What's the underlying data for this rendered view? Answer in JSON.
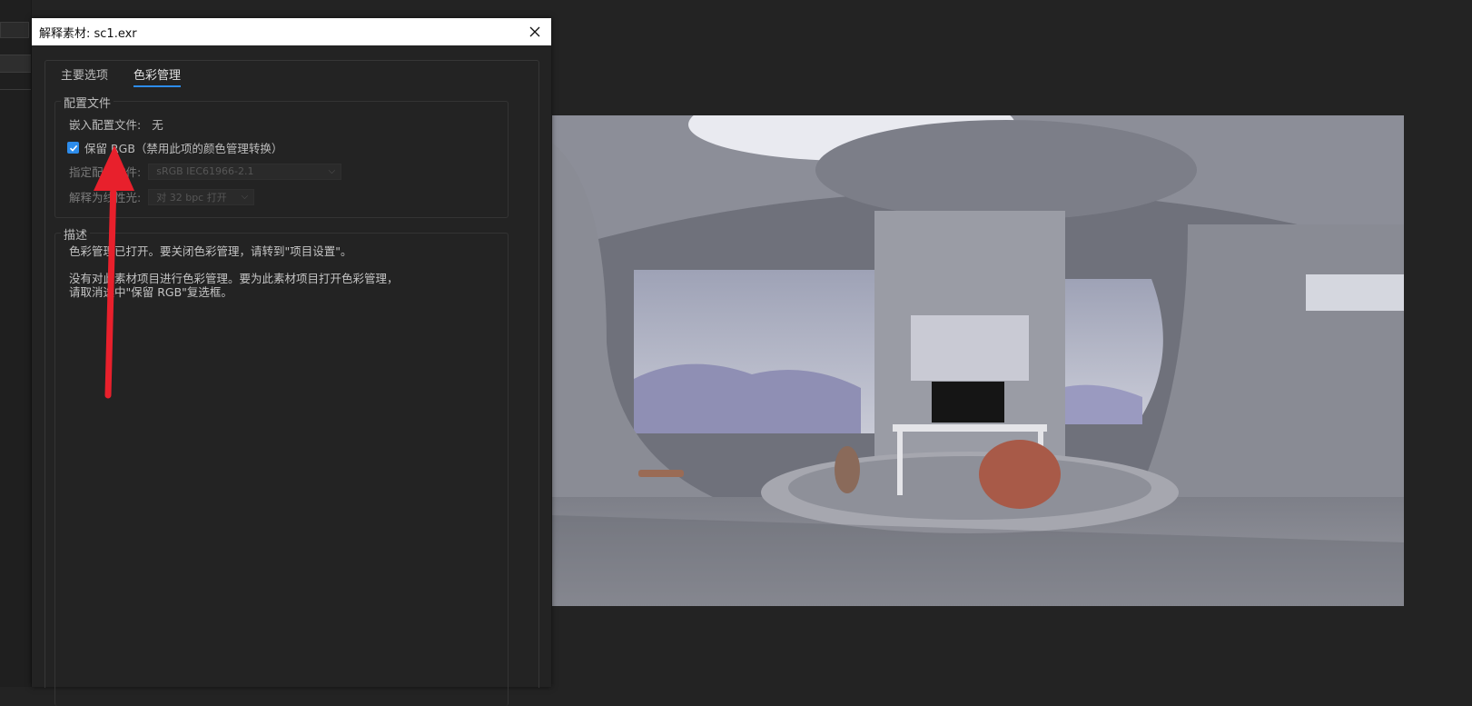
{
  "dialog": {
    "title": "解释素材: sc1.exr",
    "tabs": [
      {
        "label": "主要选项",
        "active": false
      },
      {
        "label": "色彩管理",
        "active": true
      }
    ],
    "profile_group": {
      "title": "配置文件",
      "embedded_label": "嵌入配置文件:",
      "embedded_value": "无",
      "preserve_rgb_label": "保留 RGB（禁用此项的颜色管理转换）",
      "preserve_rgb_checked": true,
      "assign_profile_label": "指定配置文件:",
      "assign_profile_value": "sRGB IEC61966-2.1",
      "interpret_linear_label": "解释为线性光:",
      "interpret_linear_value": "对 32 bpc 打开"
    },
    "description_group": {
      "title": "描述",
      "line1": "色彩管理已打开。要关闭色彩管理，请转到\"项目设置\"。",
      "line2": "没有对此素材项目进行色彩管理。要为此素材项目打开色彩管理，",
      "line3": "请取消选中\"保留 RGB\"复选框。"
    }
  },
  "colors": {
    "accent": "#2d8ceb",
    "annotation_arrow": "#e8202c",
    "background": "#232323"
  }
}
